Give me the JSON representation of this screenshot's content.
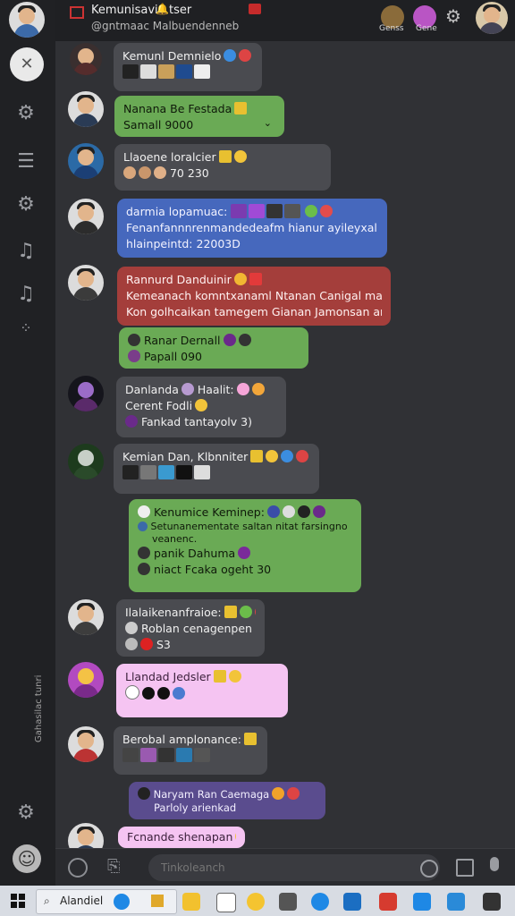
{
  "header": {
    "title": "Kemunisavi",
    "title_suffix": "tser",
    "subtitle": "@gntmaac Malbuendenneb",
    "right_label_1": "Genss",
    "right_label_2": "Gene"
  },
  "sidebar": {
    "items": [
      {
        "icon": "close-icon"
      },
      {
        "icon": "gear-icon"
      },
      {
        "icon": "list-icon"
      },
      {
        "icon": "gear-icon"
      },
      {
        "icon": "music-note-icon"
      },
      {
        "icon": "music-note-icon"
      },
      {
        "icon": "more-icon"
      }
    ],
    "vertical_label": "Gahasilac tunri",
    "bottom_icons": [
      "settings-icon",
      "emoji-icon"
    ]
  },
  "messages": [
    {
      "name": "Kemunl Demnielo",
      "lines": []
    },
    {
      "name": "Nanana Be Festada",
      "lines": [
        "Samall 9000"
      ]
    },
    {
      "name": "Llaoene loralcier",
      "lines": [
        "70 230"
      ]
    },
    {
      "name": "darmia lopamuac:",
      "lines": [
        "Fenanfannnrenmandedeafm hianur ayileyxall enan.",
        "hlainpeintd: 22003D"
      ]
    },
    {
      "name": "Rannurd Danduinir",
      "lines": [
        "Kemeanach komntxanaml Ntanan Canigal man Cadoan",
        "Kon golhcaikan tamegem Gianan Jamonsan anka....)"
      ]
    },
    {
      "name": "Ranar Dernall",
      "lines": [
        "Papall 090"
      ]
    },
    {
      "name": "Danlanda",
      "name_suffix": "Haalit:",
      "lines": [
        "Cerent Fodli",
        "Fankad tantayolv  3)"
      ]
    },
    {
      "name": "Kemian Dan, Klbnniter",
      "lines": []
    },
    {
      "name": "Kenumice Keminep:",
      "lines": [
        "Setunanementate saltan nitat farsingno",
        "veanenc.",
        "panik Dahuma",
        "niact Fcaka ogeht 30"
      ]
    },
    {
      "name": "Ilalaikenanfraioe:",
      "lines": [
        "Roblan cenagenpen",
        "S3"
      ]
    },
    {
      "name": "Llandad Jedsler",
      "lines": []
    },
    {
      "name": "Berobal amplonance:",
      "lines": []
    },
    {
      "name": "Naryam Ran Caemaga",
      "lines": [
        "Parloly arienkad"
      ]
    },
    {
      "name": "Fcnande shenapan",
      "lines": []
    }
  ],
  "composer": {
    "placeholder": "Tinkoleanch"
  },
  "taskbar": {
    "search_label": "Alandiel"
  },
  "colors": {
    "green": "#6aaa55",
    "blue": "#4668bd",
    "red": "#a43e3b",
    "pink": "#f5c4f2",
    "purple": "#5a4c8e",
    "grey": "#4a4b50"
  }
}
